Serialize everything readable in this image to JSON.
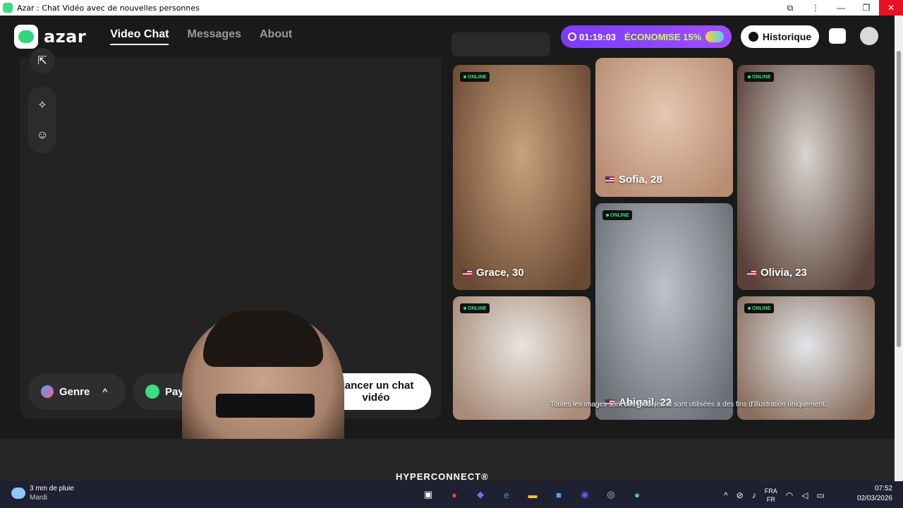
{
  "window": {
    "title": "Azar : Chat Vidéo avec de nouvelles personnes",
    "controls": {
      "extension": "⧉",
      "menu": "⋮",
      "minimize": "—",
      "restore": "❐",
      "close": "✕"
    }
  },
  "header": {
    "logo_text": "azar",
    "nav": [
      {
        "label": "Video Chat",
        "active": true
      },
      {
        "label": "Messages",
        "active": false
      },
      {
        "label": "About",
        "active": false
      }
    ],
    "promo": {
      "timer": "01:19:03",
      "label": "ÉCONOMISE 15%"
    },
    "history_label": "Historique"
  },
  "video_panel": {
    "tools": {
      "top_icon": "⇱",
      "magic_icon": "✧",
      "face_icon": "☺"
    },
    "filters": {
      "gender_label": "Genre",
      "gender_chevron": "^",
      "country_label": "Pays"
    },
    "launch_label_line1": "Lancer un chat",
    "launch_label_line2": "vidéo"
  },
  "profiles": {
    "online_label": "ONLINE",
    "cards": [
      {
        "name": "Grace, 30",
        "online": true,
        "colors": [
          "#c9a27e",
          "#6b4a33"
        ]
      },
      {
        "name": "Sofia, 28",
        "online": false,
        "colors": [
          "#e6c7b0",
          "#b88e73"
        ]
      },
      {
        "name": "Olivia, 23",
        "online": true,
        "colors": [
          "#d8d4cf",
          "#5a4238"
        ]
      },
      {
        "name": "",
        "online": true,
        "colors": [
          "#e9e4de",
          "#a88c7a"
        ]
      },
      {
        "name": "Abigail, 22",
        "online": true,
        "colors": [
          "#bfc3c8",
          "#6b7078"
        ]
      },
      {
        "name": "",
        "online": true,
        "colors": [
          "#e2e6ea",
          "#8a6f5e"
        ]
      }
    ],
    "disclaimer": "Toutes les images sont des modèles et sont utilisées à des fins d'illustration uniquement."
  },
  "footer": {
    "brand": "HYPERCONNECT®"
  },
  "taskbar": {
    "weather_line1": "3 mm de pluie",
    "weather_line2": "Mardi",
    "apps": [
      {
        "name": "task-view",
        "glyph": "▣",
        "color": "#ffffff"
      },
      {
        "name": "chrome",
        "glyph": "●",
        "color": "#ea4335"
      },
      {
        "name": "copilot",
        "glyph": "◆",
        "color": "#7f6bff"
      },
      {
        "name": "edge",
        "glyph": "e",
        "color": "#1fa3e0"
      },
      {
        "name": "file-explorer",
        "glyph": "▬",
        "color": "#f6c343"
      },
      {
        "name": "store",
        "glyph": "■",
        "color": "#4ea1ff"
      },
      {
        "name": "discord",
        "glyph": "◉",
        "color": "#5865f2"
      },
      {
        "name": "obs",
        "glyph": "◎",
        "color": "#cccccc"
      },
      {
        "name": "azar",
        "glyph": "●",
        "color": "#3ddc84"
      }
    ],
    "tray": {
      "chevron": "^",
      "lang_line1": "FRA",
      "lang_line2": "FR",
      "time": "07:52",
      "date": "02/03/2026"
    }
  }
}
